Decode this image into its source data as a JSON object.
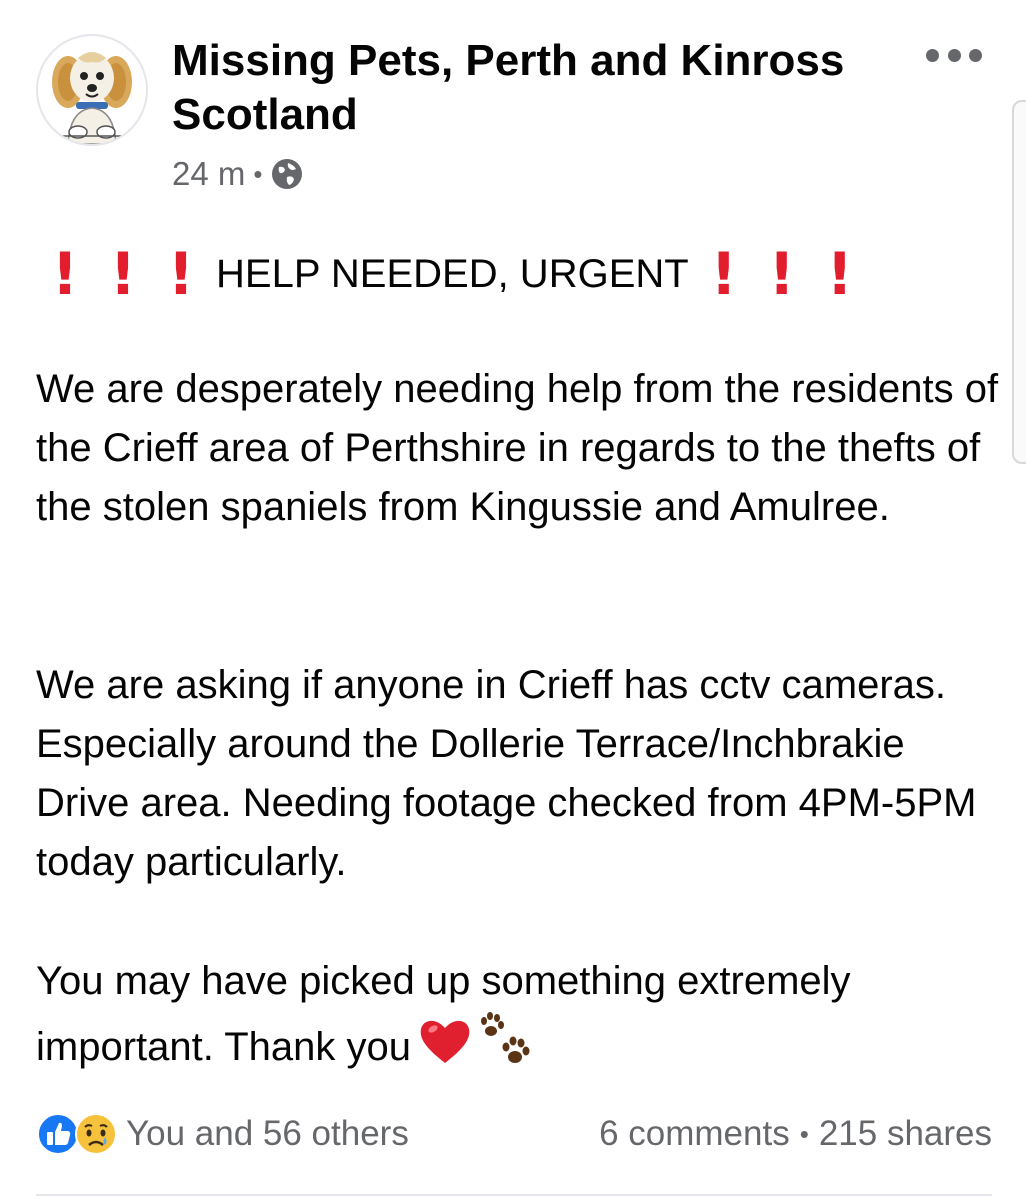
{
  "header": {
    "page_name": "Missing Pets, Perth and Kinross Scotland",
    "time": "24 m",
    "separator": "•",
    "audience_icon": "globe-icon",
    "more_icon": "more-options-icon"
  },
  "post": {
    "headline": "HELP NEEDED, URGENT",
    "headline_icon": "exclamation-icon",
    "paragraph_1": "We are desperately needing help from the residents of the Crieff area of Perthshire in regards to the thefts of the stolen spaniels from Kingussie and Amulree.",
    "paragraph_2": "We are asking if anyone in Crieff has cctv cameras. Especially around the Dollerie Terrace/Inchbrakie Drive area. Needing footage checked from 4PM-5PM today particularly.",
    "paragraph_3": "You may have picked up something extremely important. Thank you",
    "trailing_emojis": [
      "heart-icon",
      "paw-prints-icon"
    ]
  },
  "footer": {
    "reaction_icons": [
      "like-icon",
      "sad-icon"
    ],
    "reactions_text": "You and 56 others",
    "comments": "6 comments",
    "separator": "•",
    "shares": "215 shares"
  },
  "colors": {
    "text": "#050505",
    "secondary_text": "#65676b",
    "like_blue": "#1877f2",
    "exclamation_red": "#e11d2e",
    "heart_red": "#e0202f"
  }
}
